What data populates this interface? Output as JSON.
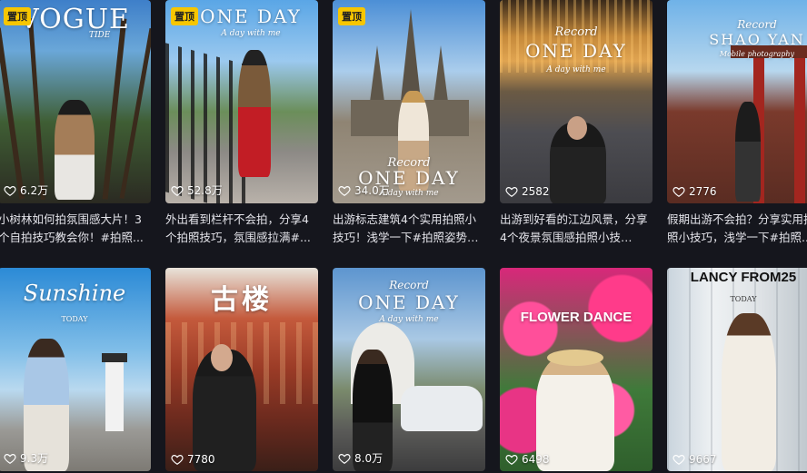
{
  "pin_label": "置顶",
  "cards": [
    {
      "overlay_big": "VOGUE",
      "overlay_sub": "TIDE",
      "likes": "6.2万",
      "title": "小树林如何拍氛围感大片！3个自拍技巧教会你！#拍照...",
      "pinned": true
    },
    {
      "overlay_big": "ONE DAY",
      "overlay_sub": "A day with me",
      "likes": "52.8万",
      "title": "外出看到栏杆不会拍，分享4个拍照技巧，氛围感拉满#...",
      "pinned": true
    },
    {
      "overlay_big": "ONE DAY",
      "overlay_sub": "A day with me",
      "overlay_script": "Record",
      "likes": "34.0万",
      "title": "出游标志建筑4个实用拍照小技巧！浅学一下#拍照姿势 #...",
      "pinned": true
    },
    {
      "overlay_big": "ONE DAY",
      "overlay_sub": "A day with me",
      "overlay_script": "Record",
      "likes": "2582",
      "title": "出游到好看的江边风景，分享4个夜景氛围感拍照小技巧，...",
      "pinned": false
    },
    {
      "overlay_big": "SHAO YAN",
      "overlay_sub": "Mobile photography",
      "overlay_script": "Record",
      "likes": "2776",
      "title": "假期出游不会拍？分享实用拍照小技巧，浅学一下#拍照...",
      "pinned": false
    },
    {
      "overlay_big": "Sunshine",
      "overlay_sub": "TODAY",
      "likes": "9.3万",
      "title": "",
      "pinned": false
    },
    {
      "overlay_big": "古楼",
      "overlay_sub": "",
      "likes": "7780",
      "title": "",
      "pinned": false
    },
    {
      "overlay_big": "ONE DAY",
      "overlay_sub": "A day with me",
      "overlay_script": "Record",
      "likes": "8.0万",
      "title": "",
      "pinned": false
    },
    {
      "overlay_big": "FLOWER DANCE",
      "overlay_sub": "",
      "likes": "6498",
      "title": "",
      "pinned": false
    },
    {
      "overlay_big": "LANCY FROM25",
      "overlay_sub": "TODAY",
      "likes": "9667",
      "title": "",
      "pinned": false
    }
  ]
}
